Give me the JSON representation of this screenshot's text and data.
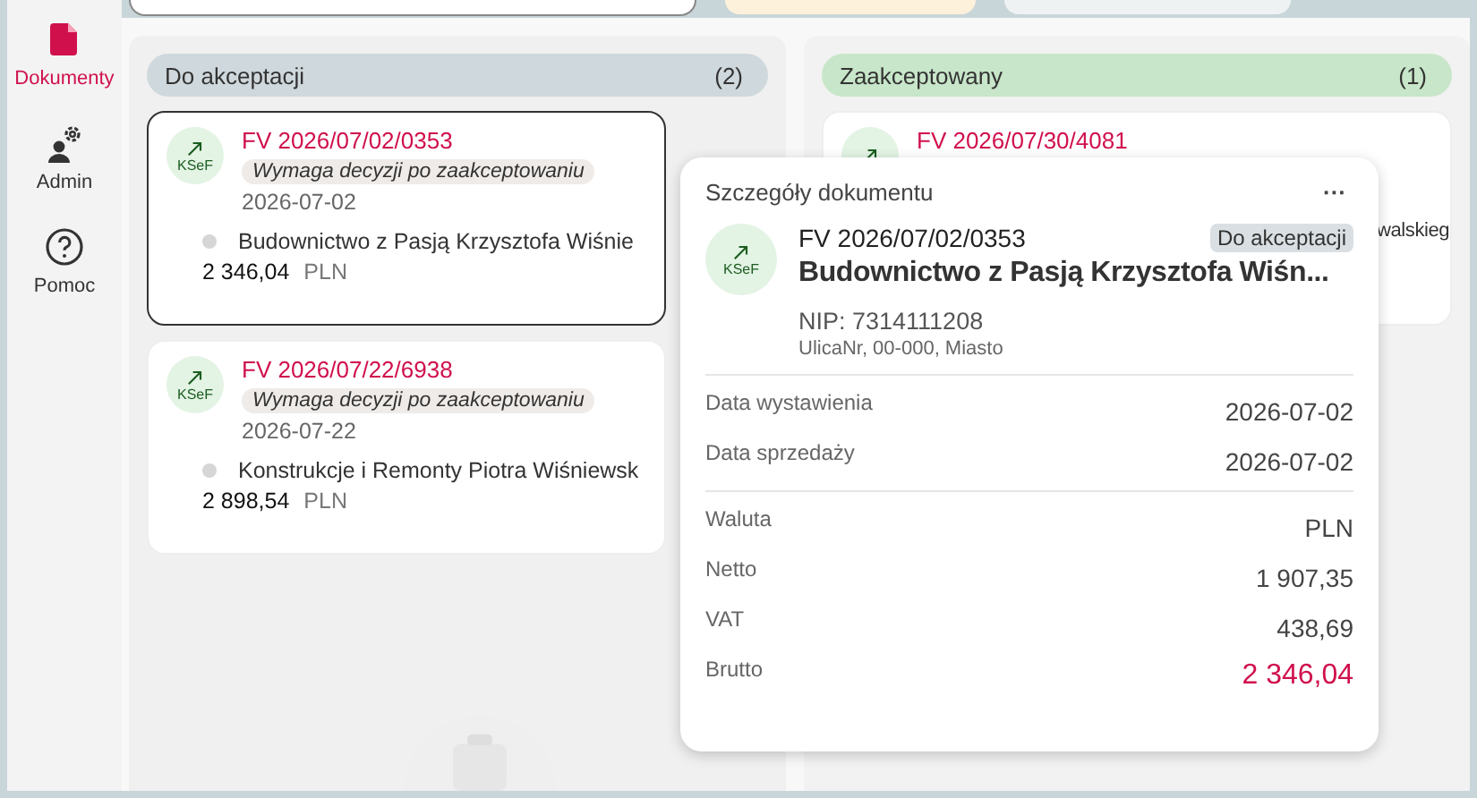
{
  "sidebar": {
    "items": [
      {
        "label": "Dokumenty",
        "selected": true
      },
      {
        "label": "Admin",
        "selected": false
      },
      {
        "label": "Pomoc",
        "selected": false
      }
    ]
  },
  "columns": [
    {
      "title": "Do akceptacji",
      "count": "(2)",
      "color": "#cfd8dc",
      "cards": [
        {
          "source": "KSeF",
          "number": "FV 2026/07/02/0353",
          "badge": "Wymaga decyzji po zaakceptowaniu",
          "date": "2026-07-02",
          "company": "Budownictwo z Pasją Krzysztofa Wiśnie",
          "amount": "2 346,04",
          "currency": "PLN",
          "selected": true
        },
        {
          "source": "KSeF",
          "number": "FV 2026/07/22/6938",
          "badge": "Wymaga decyzji po zaakceptowaniu",
          "date": "2026-07-22",
          "company": "Konstrukcje i Remonty Piotra Wiśniewsk",
          "amount": "2 898,54",
          "currency": "PLN",
          "selected": false
        }
      ]
    },
    {
      "title": "Zaakceptowany",
      "count": "(1)",
      "color": "#c8e6c9",
      "cards": [
        {
          "number": "FV 2026/07/30/4081",
          "company": "walskieg",
          "selected": false
        }
      ]
    }
  ],
  "popover": {
    "title": "Szczegóły dokumentu",
    "menu": "···",
    "source": "KSeF",
    "number": "FV 2026/07/02/0353",
    "status": "Do akceptacji",
    "company": "Budownictwo z Pasją Krzysztofa Wiśn...",
    "nip": "NIP: 7314111208",
    "address": "UlicaNr, 00-000, Miasto",
    "groups": [
      [
        {
          "label": "Data wystawienia",
          "value": "2026-07-02",
          "highlight": false
        },
        {
          "label": "Data sprzedaży",
          "value": "2026-07-02",
          "highlight": false
        }
      ],
      [
        {
          "label": "Waluta",
          "value": "PLN",
          "highlight": false
        },
        {
          "label": "Netto",
          "value": "1 907,35",
          "highlight": false
        },
        {
          "label": "VAT",
          "value": "438,69",
          "highlight": false
        },
        {
          "label": "Brutto",
          "value": "2 346,04",
          "highlight": true
        }
      ]
    ]
  }
}
